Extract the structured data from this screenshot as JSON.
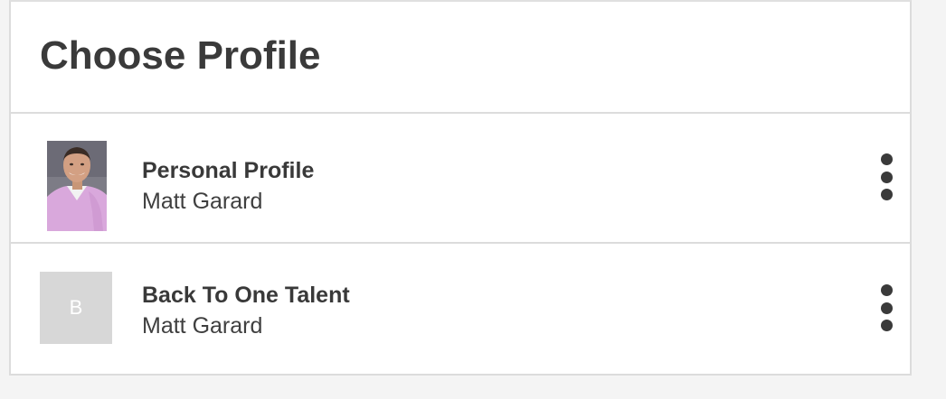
{
  "header": {
    "title": "Choose Profile"
  },
  "profiles": [
    {
      "name": "Personal Profile",
      "owner": "Matt Garard",
      "avatar_type": "photo"
    },
    {
      "name": "Back To One Talent",
      "owner": "Matt Garard",
      "avatar_type": "initial",
      "avatar_initial": "B"
    }
  ],
  "icons": {
    "row_menu": "more-vertical-icon"
  },
  "colors": {
    "background": "#f4f4f4",
    "panel": "#ffffff",
    "border": "#dcdcdc",
    "text": "#393939",
    "avatar_placeholder": "#d7d7d7"
  }
}
